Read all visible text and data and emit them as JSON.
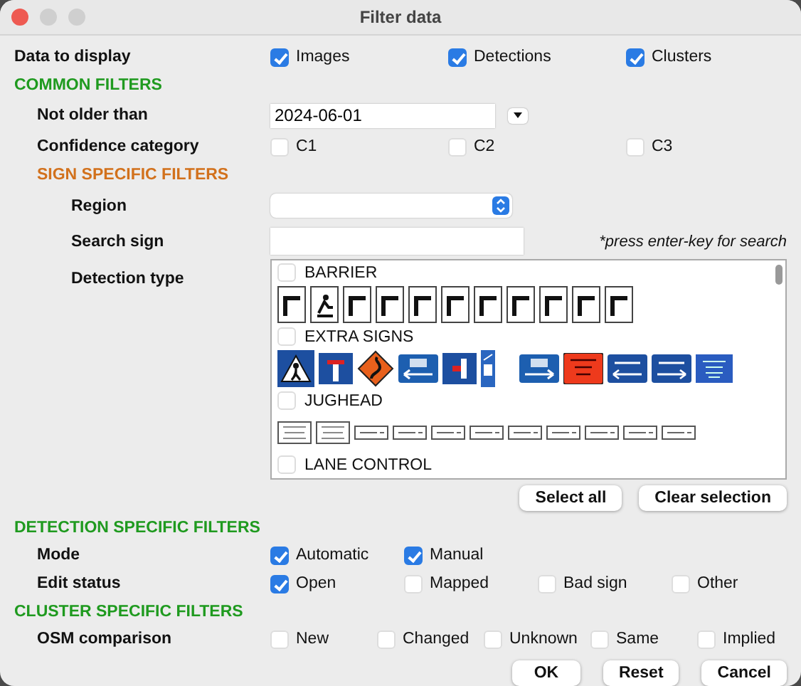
{
  "window": {
    "title": "Filter data"
  },
  "rows": [
    {
      "kind": "checks",
      "label": "Data to display",
      "options": [
        {
          "label": "Images",
          "checked": true
        },
        {
          "label": "Detections",
          "checked": true
        },
        {
          "label": "Clusters",
          "checked": true
        }
      ]
    },
    {
      "kind": "section",
      "title": "COMMON FILTERS",
      "color": "#1f9a1f",
      "children": [
        {
          "kind": "date",
          "label": "Not older than",
          "value": "2024-06-01"
        },
        {
          "kind": "checks",
          "label": "Confidence category",
          "options": [
            {
              "label": "C1",
              "checked": false
            },
            {
              "label": "C2",
              "checked": false
            },
            {
              "label": "C3",
              "checked": false
            }
          ]
        },
        {
          "kind": "section",
          "title": "SIGN SPECIFIC FILTERS",
          "color": "#d2711c",
          "children": [
            {
              "kind": "select",
              "label": "Region"
            },
            {
              "kind": "search",
              "label": "Search sign",
              "hint": "*press enter-key for search"
            },
            {
              "kind": "signs",
              "label": "Detection type",
              "groups": [
                {
                  "name": "BARRIER",
                  "checked": false,
                  "signs": [
                    {
                      "kind": "barrier"
                    },
                    {
                      "kind": "barrier-person"
                    },
                    {
                      "kind": "barrier"
                    },
                    {
                      "kind": "barrier"
                    },
                    {
                      "kind": "barrier"
                    },
                    {
                      "kind": "barrier"
                    },
                    {
                      "kind": "barrier"
                    },
                    {
                      "kind": "barrier"
                    },
                    {
                      "kind": "barrier"
                    },
                    {
                      "kind": "barrier"
                    },
                    {
                      "kind": "barrier"
                    }
                  ]
                },
                {
                  "name": "EXTRA SIGNS",
                  "checked": false,
                  "signs": [
                    {
                      "kind": "pedestrian"
                    },
                    {
                      "kind": "dead-end"
                    },
                    {
                      "kind": "curve"
                    },
                    {
                      "kind": "exit-left"
                    },
                    {
                      "kind": "side-road"
                    },
                    {
                      "kind": "bus"
                    },
                    {
                      "kind": "exit-right"
                    },
                    {
                      "kind": "red-panel"
                    },
                    {
                      "kind": "way-out-left"
                    },
                    {
                      "kind": "way-out-right"
                    },
                    {
                      "kind": "blue-panel"
                    }
                  ]
                },
                {
                  "name": "JUGHEAD",
                  "checked": false,
                  "signs": [
                    {
                      "kind": "tall-panel"
                    },
                    {
                      "kind": "tall-panel"
                    },
                    {
                      "kind": "text-panel"
                    },
                    {
                      "kind": "text-panel"
                    },
                    {
                      "kind": "text-panel"
                    },
                    {
                      "kind": "text-panel"
                    },
                    {
                      "kind": "text-panel"
                    },
                    {
                      "kind": "text-panel"
                    },
                    {
                      "kind": "text-panel"
                    },
                    {
                      "kind": "text-panel"
                    },
                    {
                      "kind": "text-panel"
                    }
                  ]
                },
                {
                  "name": "LANE CONTROL",
                  "checked": false
                }
              ],
              "buttons": [
                "Select all",
                "Clear selection"
              ]
            }
          ]
        }
      ]
    },
    {
      "kind": "section",
      "title": "DETECTION SPECIFIC FILTERS",
      "color": "#1f9a1f",
      "children": [
        {
          "kind": "checks",
          "label": "Mode",
          "options": [
            {
              "label": "Automatic",
              "checked": true
            },
            {
              "label": "Manual",
              "checked": true
            }
          ]
        },
        {
          "kind": "checks",
          "label": "Edit status",
          "options": [
            {
              "label": "Open",
              "checked": true
            },
            {
              "label": "Mapped",
              "checked": false
            },
            {
              "label": "Bad sign",
              "checked": false
            },
            {
              "label": "Other",
              "checked": false
            }
          ]
        }
      ]
    },
    {
      "kind": "section",
      "title": "CLUSTER SPECIFIC FILTERS",
      "color": "#1f9a1f",
      "children": [
        {
          "kind": "checks",
          "label": "OSM comparison",
          "options": [
            {
              "label": "New",
              "checked": false
            },
            {
              "label": "Changed",
              "checked": false
            },
            {
              "label": "Unknown",
              "checked": false
            },
            {
              "label": "Same",
              "checked": false
            },
            {
              "label": "Implied",
              "checked": false
            }
          ]
        }
      ]
    }
  ],
  "buttons": [
    "OK",
    "Reset",
    "Cancel"
  ]
}
